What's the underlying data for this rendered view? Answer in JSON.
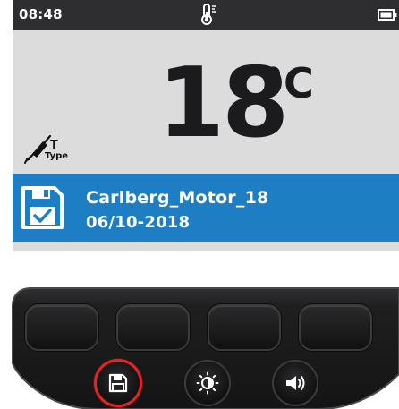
{
  "status_bar": {
    "time": "08:48",
    "center_icon": "thermometer-icon",
    "right_icon": "battery-icon"
  },
  "reading": {
    "value": "18",
    "unit": "°C"
  },
  "probe": {
    "icon": "probe-icon",
    "type_letter": "T",
    "type_label": "Type"
  },
  "save_bar": {
    "icon": "save-check-icon",
    "name": "Carlberg_Motor_18",
    "date": "06/10-2018"
  },
  "keypad": {
    "softkeys": [
      "",
      "",
      "",
      ""
    ],
    "buttons": [
      {
        "icon": "save-icon",
        "active": true
      },
      {
        "icon": "brightness-icon",
        "active": false
      },
      {
        "icon": "speaker-icon",
        "active": false
      }
    ]
  },
  "colors": {
    "status_bar": "#2e2e30",
    "screen_bg": "#dcdcdc",
    "save_bar": "#1e7ec4",
    "active_ring": "#e0262a",
    "keypad_body": "#1c1c1d"
  }
}
